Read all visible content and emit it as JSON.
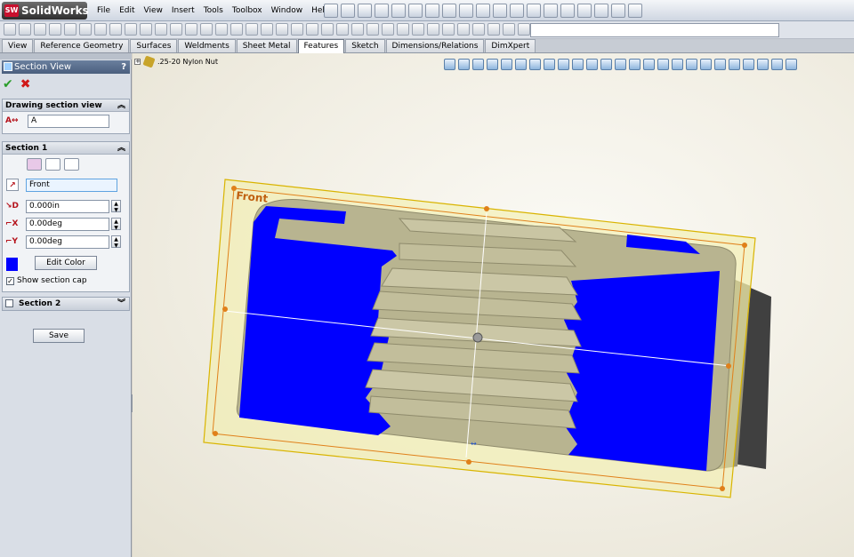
{
  "app": {
    "brand": "SolidWorks",
    "brand_mark": "SW",
    "menus": [
      "File",
      "Edit",
      "View",
      "Insert",
      "Tools",
      "Toolbox",
      "Window",
      "Help"
    ]
  },
  "tabs": [
    {
      "label": "View",
      "active": false
    },
    {
      "label": "Reference Geometry",
      "active": false
    },
    {
      "label": "Surfaces",
      "active": false
    },
    {
      "label": "Weldments",
      "active": false
    },
    {
      "label": "Sheet Metal",
      "active": false
    },
    {
      "label": "Features",
      "active": true
    },
    {
      "label": "Sketch",
      "active": false
    },
    {
      "label": "Dimensions/Relations",
      "active": false
    },
    {
      "label": "DimXpert",
      "active": false
    }
  ],
  "property_manager": {
    "title": "Section View",
    "help": "?",
    "ok": "✔",
    "cancel": "✖",
    "drawing_section": {
      "heading": "Drawing section view",
      "name_value": "A"
    },
    "section1": {
      "heading": "Section 1",
      "plane_value": "Front",
      "offset_value": "0.000in",
      "rot_x_value": "0.00deg",
      "rot_y_value": "0.00deg",
      "edit_color_label": "Edit Color",
      "show_cap_label": "Show section cap",
      "show_cap_checked": true,
      "cap_color": "#0000ff"
    },
    "section2": {
      "heading": "Section 2",
      "checked": false
    },
    "save_label": "Save"
  },
  "feature_tree": {
    "part_name": ".25-20 Nylon Nut"
  },
  "viewport": {
    "plane_label": "Front",
    "colors": {
      "section_cap": "#0000ff",
      "part_body": "#b8b490",
      "plane_fill": "#f3efa6",
      "plane_border": "#d9b400",
      "handles": "#e0801a"
    }
  }
}
